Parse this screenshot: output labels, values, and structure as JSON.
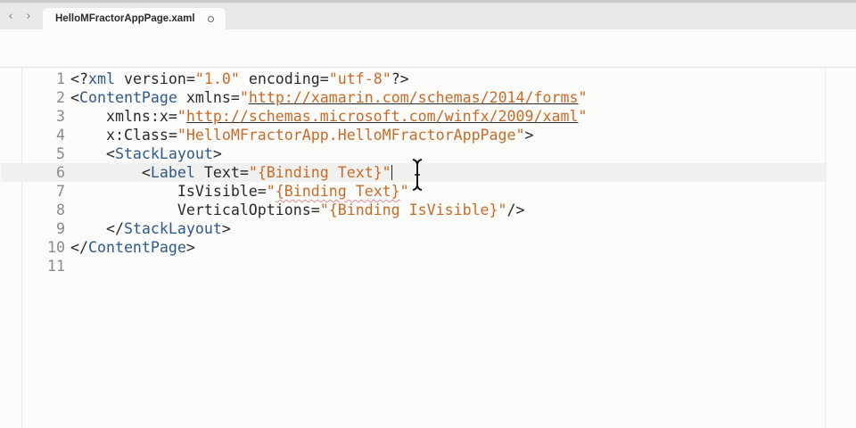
{
  "tabbar": {
    "back_icon": "chevron-left-icon",
    "forward_icon": "chevron-right-icon",
    "active_tab": {
      "title": "HelloMFractorAppPage.xaml",
      "close_icon": "unsaved-dot-close-icon"
    }
  },
  "editor": {
    "current_line": 6,
    "cursor_icon": "text-ibeam-cursor-icon",
    "lines": [
      {
        "number": "1",
        "tokens": [
          {
            "t": "<?",
            "c": "plain"
          },
          {
            "t": "xml",
            "c": "tag"
          },
          {
            "t": " version=",
            "c": "plain"
          },
          {
            "t": "\"1.0\"",
            "c": "str"
          },
          {
            "t": " encoding=",
            "c": "plain"
          },
          {
            "t": "\"utf-8\"",
            "c": "str"
          },
          {
            "t": "?>",
            "c": "plain"
          }
        ]
      },
      {
        "number": "2",
        "tokens": [
          {
            "t": "<",
            "c": "plain"
          },
          {
            "t": "ContentPage",
            "c": "tag"
          },
          {
            "t": " xmlns=",
            "c": "plain"
          },
          {
            "t": "\"",
            "c": "str"
          },
          {
            "t": "http://xamarin.com/schemas/2014/forms",
            "c": "url"
          },
          {
            "t": "\"",
            "c": "str"
          }
        ]
      },
      {
        "number": "3",
        "tokens": [
          {
            "t": "    xmlns:x=",
            "c": "plain"
          },
          {
            "t": "\"",
            "c": "str"
          },
          {
            "t": "http://schemas.microsoft.com/winfx/2009/xaml",
            "c": "url"
          },
          {
            "t": "\"",
            "c": "str"
          }
        ]
      },
      {
        "number": "4",
        "tokens": [
          {
            "t": "    x:Class=",
            "c": "plain"
          },
          {
            "t": "\"HelloMFractorApp.HelloMFractorAppPage\"",
            "c": "str"
          },
          {
            "t": ">",
            "c": "plain"
          }
        ]
      },
      {
        "number": "5",
        "tokens": [
          {
            "t": "    <",
            "c": "plain"
          },
          {
            "t": "StackLayout",
            "c": "tag"
          },
          {
            "t": ">",
            "c": "plain"
          }
        ]
      },
      {
        "number": "6",
        "tokens": [
          {
            "t": "        <",
            "c": "plain"
          },
          {
            "t": "Label",
            "c": "tag"
          },
          {
            "t": " Text=",
            "c": "plain"
          },
          {
            "t": "\"{Binding Text}\"",
            "c": "str"
          }
        ]
      },
      {
        "number": "7",
        "tokens": [
          {
            "t": "            IsVisible=",
            "c": "plain"
          },
          {
            "t": "\"",
            "c": "str"
          },
          {
            "t": "{Binding Text}",
            "c": "str squiggle"
          },
          {
            "t": "\"",
            "c": "str"
          }
        ]
      },
      {
        "number": "8",
        "tokens": [
          {
            "t": "            VerticalOptions=",
            "c": "plain"
          },
          {
            "t": "\"{Binding IsVisible}\"",
            "c": "str"
          },
          {
            "t": "/>",
            "c": "plain"
          }
        ]
      },
      {
        "number": "9",
        "tokens": [
          {
            "t": "    </",
            "c": "plain"
          },
          {
            "t": "StackLayout",
            "c": "tag"
          },
          {
            "t": ">",
            "c": "plain"
          }
        ]
      },
      {
        "number": "10",
        "tokens": [
          {
            "t": "</",
            "c": "plain"
          },
          {
            "t": "ContentPage",
            "c": "tag"
          },
          {
            "t": ">",
            "c": "plain"
          }
        ]
      },
      {
        "number": "11",
        "tokens": []
      }
    ]
  },
  "colors": {
    "tag": "#2f5a8a",
    "string": "#c76b29",
    "plain": "#2a2a2a",
    "line_number": "#8a8a8a",
    "current_line_bg": "#f0f0ef",
    "squiggle": "#e38b8b"
  }
}
